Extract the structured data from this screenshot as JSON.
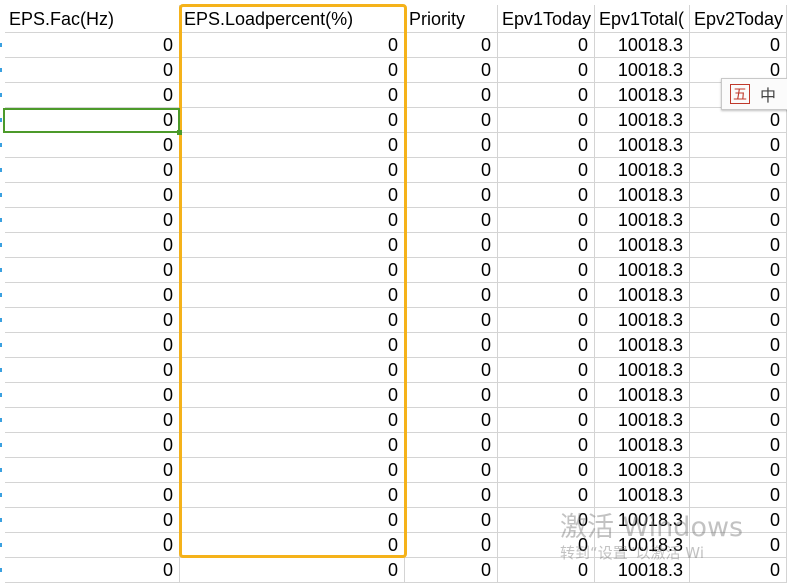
{
  "columns": [
    {
      "header": "EPS.Fac(Hz)"
    },
    {
      "header": "EPS.Loadpercent(%)"
    },
    {
      "header": "Priority"
    },
    {
      "header": "Epv1Today"
    },
    {
      "header": "Epv1Total("
    },
    {
      "header": "Epv2Today"
    }
  ],
  "rows": [
    [
      "0",
      "0",
      "0",
      "0",
      "10018.3",
      "0"
    ],
    [
      "0",
      "0",
      "0",
      "0",
      "10018.3",
      "0"
    ],
    [
      "0",
      "0",
      "0",
      "0",
      "10018.3",
      ""
    ],
    [
      "0",
      "0",
      "0",
      "0",
      "10018.3",
      "0"
    ],
    [
      "0",
      "0",
      "0",
      "0",
      "10018.3",
      "0"
    ],
    [
      "0",
      "0",
      "0",
      "0",
      "10018.3",
      "0"
    ],
    [
      "0",
      "0",
      "0",
      "0",
      "10018.3",
      "0"
    ],
    [
      "0",
      "0",
      "0",
      "0",
      "10018.3",
      "0"
    ],
    [
      "0",
      "0",
      "0",
      "0",
      "10018.3",
      "0"
    ],
    [
      "0",
      "0",
      "0",
      "0",
      "10018.3",
      "0"
    ],
    [
      "0",
      "0",
      "0",
      "0",
      "10018.3",
      "0"
    ],
    [
      "0",
      "0",
      "0",
      "0",
      "10018.3",
      "0"
    ],
    [
      "0",
      "0",
      "0",
      "0",
      "10018.3",
      "0"
    ],
    [
      "0",
      "0",
      "0",
      "0",
      "10018.3",
      "0"
    ],
    [
      "0",
      "0",
      "0",
      "0",
      "10018.3",
      "0"
    ],
    [
      "0",
      "0",
      "0",
      "0",
      "10018.3",
      "0"
    ],
    [
      "0",
      "0",
      "0",
      "0",
      "10018.3",
      "0"
    ],
    [
      "0",
      "0",
      "0",
      "0",
      "10018.3",
      "0"
    ],
    [
      "0",
      "0",
      "0",
      "0",
      "10018.3",
      "0"
    ],
    [
      "0",
      "0",
      "0",
      "0",
      "10018.3",
      "0"
    ],
    [
      "0",
      "0",
      "0",
      "0",
      "10018.3",
      "0"
    ],
    [
      "0",
      "0",
      "0",
      "0",
      "10018.3",
      "0"
    ]
  ],
  "ime": {
    "icon": "五",
    "lang": "中"
  },
  "watermark": {
    "title": "激活 Windows",
    "subtitle": "转到“设置”以激活 Wi"
  },
  "colors": {
    "highlight": "#f5b21a",
    "active_cell": "#4c9a2a",
    "grid": "#d4d4d4"
  }
}
